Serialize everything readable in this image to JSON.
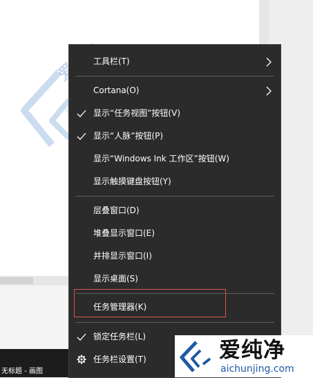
{
  "menu": {
    "items": [
      {
        "label": "工具栏(T)",
        "submenu": true
      },
      {
        "label": "Cortana(O)",
        "submenu": true
      },
      {
        "label": "显示“任务视图”按钮(V)",
        "checked": true
      },
      {
        "label": "显示“人脉”按钮(P)",
        "checked": true
      },
      {
        "label": "显示“Windows Ink 工作区”按钮(W)"
      },
      {
        "label": "显示触摸键盘按钮(Y)"
      },
      {
        "label": "层叠窗口(D)"
      },
      {
        "label": "堆叠显示窗口(E)"
      },
      {
        "label": "并排显示窗口(I)"
      },
      {
        "label": "显示桌面(S)"
      },
      {
        "label": "任务管理器(K)",
        "highlighted": true
      },
      {
        "label": "锁定任务栏(L)",
        "checked": true
      },
      {
        "label": "任务栏设置(T)",
        "icon": "gear-icon"
      }
    ]
  },
  "taskbar": {
    "window_label": "无标题 - 画图"
  },
  "watermark": {
    "title": "爱纯净",
    "url": "aichunjing.com"
  },
  "colors": {
    "menu_bg": "#2b2b2b",
    "menu_text": "#ffffff",
    "highlight_border": "#d9534f",
    "watermark_blue": "#1f5aa6"
  }
}
